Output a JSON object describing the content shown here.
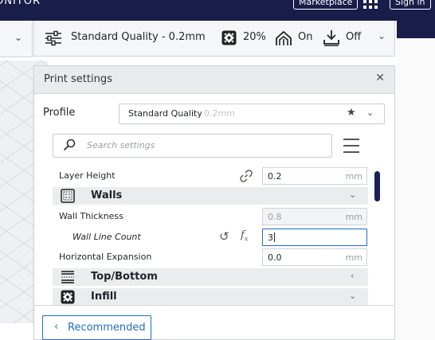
{
  "header": {
    "brand": "ONITOR",
    "marketplace_label": "Marketplace",
    "signin_label": "Sign in"
  },
  "toolbar": {
    "profile_label": "Standard Quality - 0.2mm",
    "infill_value": "20%",
    "support_value": "On",
    "adhesion_value": "Off"
  },
  "panel": {
    "title": "Print settings",
    "profile_label": "Profile",
    "profile_name": "Standard Quality",
    "profile_sub": "0.2mm",
    "search_placeholder": "Search settings",
    "settings": {
      "layer_height": {
        "label": "Layer Height",
        "value": "0.2",
        "unit": "mm"
      },
      "walls": {
        "label": "Walls"
      },
      "wall_thickness": {
        "label": "Wall Thickness",
        "value": "0.8",
        "unit": "mm"
      },
      "wall_line_count": {
        "label": "Wall Line Count",
        "value": "3"
      },
      "horizontal_expansion": {
        "label": "Horizontal Expansion",
        "value": "0.0",
        "unit": "mm"
      },
      "top_bottom": {
        "label": "Top/Bottom"
      },
      "infill": {
        "label": "Infill"
      }
    },
    "recommended_label": "Recommended"
  },
  "colors": {
    "header_bg": "#181d4a",
    "accent": "#1f6ec6",
    "scrollbar": "#1a2156"
  },
  "icons": [
    "grid-icon",
    "chevron-down-icon",
    "sliders-icon",
    "infill-icon",
    "support-icon",
    "adhesion-icon",
    "close-icon",
    "star-icon",
    "search-icon",
    "menu-icon",
    "link-icon",
    "walls-icon",
    "reset-icon",
    "function-icon",
    "top-bottom-icon",
    "chevron-left-icon"
  ]
}
